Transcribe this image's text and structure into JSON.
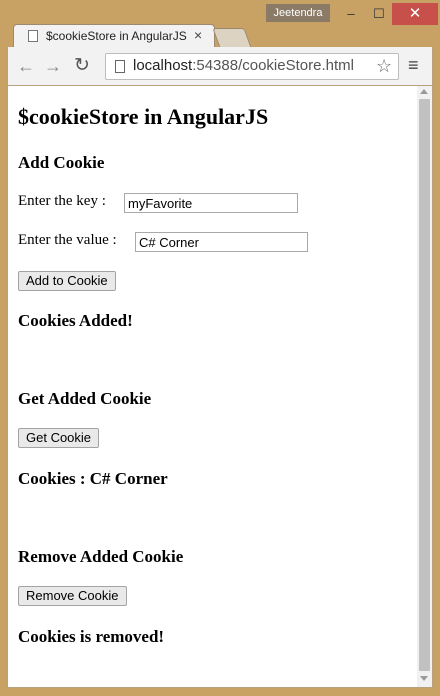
{
  "window": {
    "user": "Jeetendra",
    "min_glyph": "–",
    "max_glyph": "☐",
    "close_glyph": "✕"
  },
  "tab": {
    "title": "$cookieStore in AngularJS",
    "close_glyph": "×"
  },
  "toolbar": {
    "back_glyph": "←",
    "forward_glyph": "→",
    "reload_glyph": "↻",
    "url_host": "localhost",
    "url_path": ":54388/cookieStore.html",
    "star_glyph": "☆",
    "menu_glyph": "≡"
  },
  "page": {
    "title": "$cookieStore in AngularJS",
    "add_heading": "Add Cookie",
    "key_label": "Enter the key :",
    "key_value": "myFavorite",
    "value_label": "Enter the value :",
    "value_value": "C# Corner",
    "add_button": "Add to Cookie",
    "added_status": "Cookies Added!",
    "get_heading": "Get Added Cookie",
    "get_button": "Get Cookie",
    "cookie_result": "Cookies : C# Corner",
    "remove_heading": "Remove Added Cookie",
    "remove_button": "Remove Cookie",
    "removed_status": "Cookies is removed!"
  }
}
